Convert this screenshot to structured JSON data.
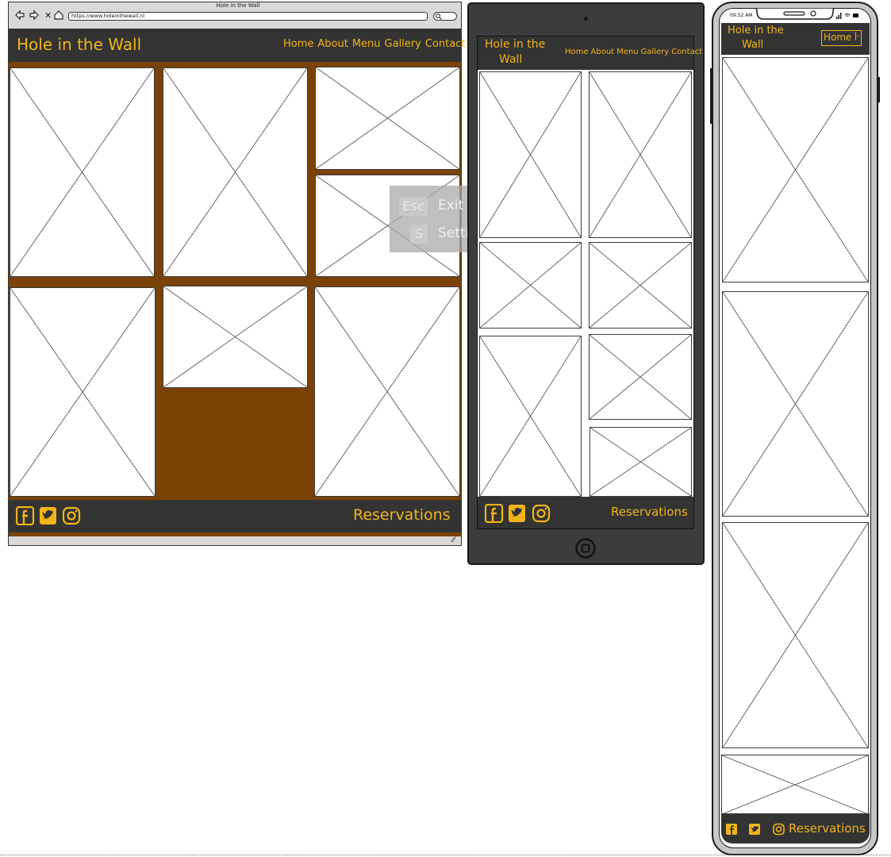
{
  "colors": {
    "accent": "#f2b418",
    "brown": "#7b4207",
    "dark": "#333333"
  },
  "desktop": {
    "window_title": "Hole in the Wall",
    "url": "https://www.holeinthewall.nl",
    "brand": "Hole in the Wall",
    "nav": [
      "Home",
      "About",
      "Menu",
      "Gallery",
      "Contact"
    ],
    "footer": {
      "reservations": "Reservations",
      "social_icons": [
        "facebook-icon",
        "twitter-icon",
        "instagram-icon"
      ]
    }
  },
  "overlay": {
    "items": [
      {
        "key": "Esc",
        "label": "Exit"
      },
      {
        "key": "S",
        "label": "Settings"
      }
    ]
  },
  "tablet": {
    "brand_line1": "Hole in the",
    "brand_line2": "Wall",
    "nav": [
      "Home",
      "About",
      "Menu",
      "Gallery",
      "Contact"
    ],
    "footer": {
      "reservations": "Reservations"
    }
  },
  "phone": {
    "status_time": "09:52 AM",
    "brand_line1": "Hole in the",
    "brand_line2": "Wall",
    "menu_select": "Home",
    "footer": {
      "reservations": "Reservations"
    }
  }
}
